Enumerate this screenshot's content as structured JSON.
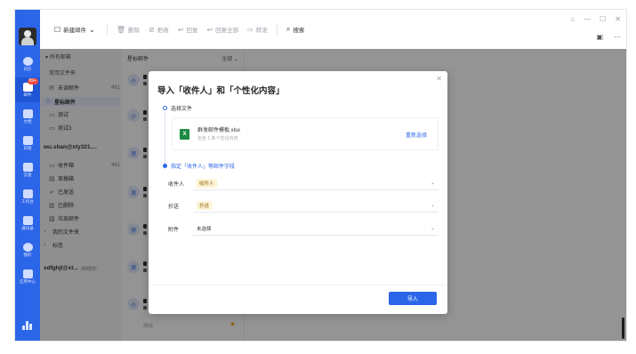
{
  "sidebar": {
    "items": [
      {
        "label": "日历",
        "icon": "calendar-icon"
      },
      {
        "label": "邮件",
        "icon": "mail-icon",
        "badge": "99+"
      },
      {
        "label": "文档",
        "icon": "docs-icon"
      },
      {
        "label": "日程",
        "icon": "schedule-icon"
      },
      {
        "label": "云盘",
        "icon": "cloud-icon"
      },
      {
        "label": "工作台",
        "icon": "apps-icon"
      },
      {
        "label": "通讯录",
        "icon": "contacts-icon"
      },
      {
        "label": "我的",
        "icon": "user-icon"
      },
      {
        "label": "应用中心",
        "icon": "app-center-icon"
      }
    ]
  },
  "toolbar": {
    "new_mail": "新建邮件",
    "delete": "删除",
    "reject": "拒收",
    "reply": "回复",
    "reply_all": "回复全部",
    "forward": "转发",
    "search": "搜索"
  },
  "folders": {
    "all_mail": "所有邮箱",
    "common": "常用文件夹",
    "items": [
      {
        "label": "未读邮件",
        "count": "461"
      },
      {
        "label": "星标邮件",
        "count": ""
      },
      {
        "label": "测试",
        "count": ""
      },
      {
        "label": "测试3",
        "count": ""
      }
    ],
    "account1": "wu.shan@xty321....",
    "account1_items": [
      {
        "label": "收件箱",
        "count": "461"
      },
      {
        "label": "草稿箱",
        "count": ""
      },
      {
        "label": "已发送",
        "count": ""
      },
      {
        "label": "已删除",
        "count": ""
      },
      {
        "label": "垃圾邮件",
        "count": ""
      },
      {
        "label": "我的文件夹",
        "count": ""
      },
      {
        "label": "标签",
        "count": ""
      }
    ],
    "account2": "sdfghjl@xt...",
    "account2_tag": "测试账号"
  },
  "mail_list": {
    "title": "星标邮件",
    "filter": "全部",
    "avatars": [
      "小",
      "小",
      "测",
      "测",
      "测",
      "测",
      "小"
    ],
    "last_sub": "测试"
  },
  "dialog": {
    "title": "导入「收件人」和「个性化内容」",
    "step1": "选择文件",
    "file_name": "群发邮件模板.xlsx",
    "file_desc": "包含 1 条个性化内容",
    "reselect": "重新选择",
    "step2": "指定「收件人」等邮件字段",
    "fields": [
      {
        "label": "收件人",
        "value": "收件人",
        "chip": true
      },
      {
        "label": "抄送",
        "value": "抄送",
        "chip": true
      },
      {
        "label": "附件",
        "value": "未选择",
        "chip": false
      }
    ],
    "import": "导入"
  },
  "colors": {
    "accent": "#2c66e8",
    "badge": "#f04a3e",
    "excel": "#1d8a44"
  }
}
